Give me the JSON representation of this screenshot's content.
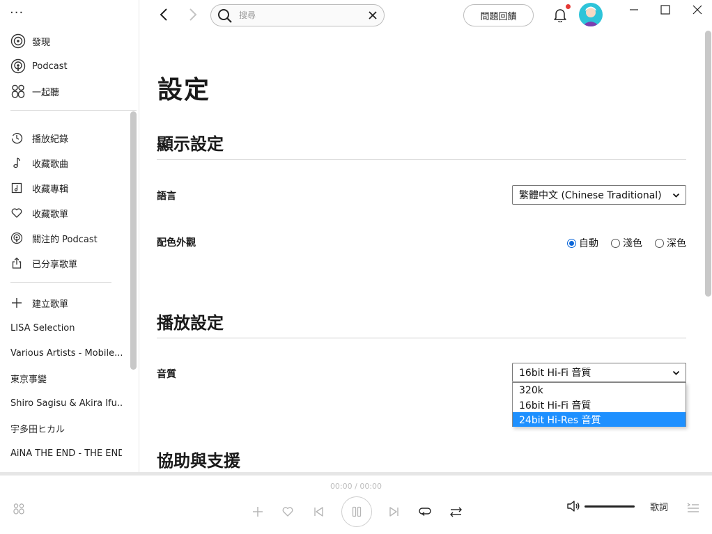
{
  "sidebar": {
    "more": "···",
    "main_nav": [
      {
        "label": "發現",
        "icon": "disc-icon"
      },
      {
        "label": "Podcast",
        "icon": "podcast-icon"
      },
      {
        "label": "一起聽",
        "icon": "listen-together-icon"
      }
    ],
    "library": [
      {
        "label": "播放紀錄",
        "icon": "history-icon"
      },
      {
        "label": "收藏歌曲",
        "icon": "music-note-icon"
      },
      {
        "label": "收藏專輯",
        "icon": "album-icon"
      },
      {
        "label": "收藏歌單",
        "icon": "heart-icon"
      },
      {
        "label": "關注的 Podcast",
        "icon": "podcast-icon"
      },
      {
        "label": "已分享歌單",
        "icon": "share-icon"
      }
    ],
    "create_playlist": "建立歌單",
    "playlists": [
      "LISA Selection",
      "Various Artists - Mobile...",
      "東京事變",
      "Shiro Sagisu & Akira Ifu...",
      "宇多田ヒカル",
      "AiNA THE END - THE END"
    ]
  },
  "topbar": {
    "search_placeholder": "搜尋",
    "feedback_label": "問題回饋"
  },
  "settings": {
    "page_title": "設定",
    "display_section": "顯示設定",
    "language_label": "語言",
    "language_value": "繁體中文 (Chinese Traditional)",
    "theme_label": "配色外觀",
    "theme_options": [
      "自動",
      "淺色",
      "深色"
    ],
    "theme_selected": "自動",
    "playback_section": "播放設定",
    "quality_label": "音質",
    "quality_value": "16bit Hi-Fi 音質",
    "quality_options": [
      "320k",
      "16bit Hi-Fi 音質",
      "24bit Hi-Res 音質"
    ],
    "quality_highlighted": "24bit Hi-Res 音質",
    "help_section": "協助與支援"
  },
  "player": {
    "time": "00:00 / 00:00",
    "lyrics_label": "歌詞"
  },
  "colors": {
    "accent_blue": "#0a66d8",
    "highlight": "#1e90ff",
    "notification": "#e53935",
    "avatar_bg": "#2ec4d9"
  }
}
